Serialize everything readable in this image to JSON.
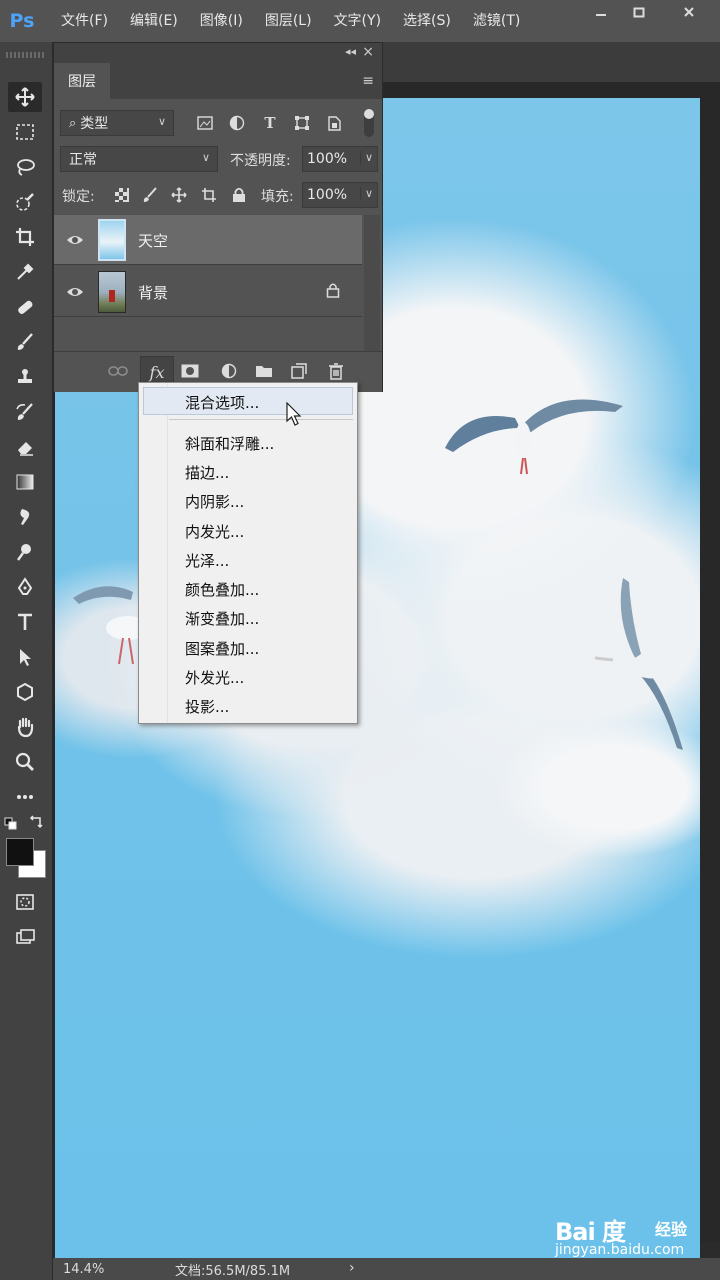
{
  "app": {
    "logo": "Ps",
    "menus": [
      "文件(F)",
      "编辑(E)",
      "图像(I)",
      "图层(L)",
      "文字(Y)",
      "选择(S)",
      "滤镜(T)"
    ],
    "window_controls": [
      "minimize-icon",
      "restore-icon",
      "close-icon"
    ]
  },
  "toolbar": {
    "tools": [
      "move-icon",
      "marquee-icon",
      "lasso-icon",
      "quick-select-icon",
      "crop-icon",
      "eyedropper-icon",
      "healing-icon",
      "brush-icon",
      "stamp-icon",
      "history-brush-icon",
      "eraser-icon",
      "gradient-icon",
      "blur-icon",
      "dodge-icon",
      "pen-icon",
      "type-icon",
      "path-select-icon",
      "shape-icon",
      "hand-icon",
      "zoom-icon",
      "more-icon"
    ],
    "foreground_color": "#111111",
    "background_color": "#ffffff"
  },
  "layers_panel": {
    "tab_label": "图层",
    "filter_kind": "类型",
    "blend_mode": "正常",
    "opacity_label": "不透明度:",
    "opacity_value": "100%",
    "lock_label": "锁定:",
    "fill_label": "填充:",
    "fill_value": "100%",
    "layers": [
      {
        "name": "天空",
        "visible": true,
        "selected": true,
        "locked": false
      },
      {
        "name": "背景",
        "visible": true,
        "selected": false,
        "locked": true
      }
    ],
    "footer_icons": [
      "link-icon",
      "fx-icon",
      "mask-icon",
      "adjustment-icon",
      "group-folder-icon",
      "new-layer-icon",
      "trash-icon"
    ],
    "fx_label": "fx"
  },
  "fx_menu": {
    "items": [
      "混合选项...",
      "斜面和浮雕...",
      "描边...",
      "内阴影...",
      "内发光...",
      "光泽...",
      "颜色叠加...",
      "渐变叠加...",
      "图案叠加...",
      "外发光...",
      "投影..."
    ],
    "highlighted_index": 0
  },
  "status": {
    "zoom": "14.4%",
    "doc_size": "文档:56.5M/85.1M"
  },
  "watermark": {
    "logo": "Bai 度",
    "cn": "经验",
    "url": "jingyan.baidu.com"
  }
}
